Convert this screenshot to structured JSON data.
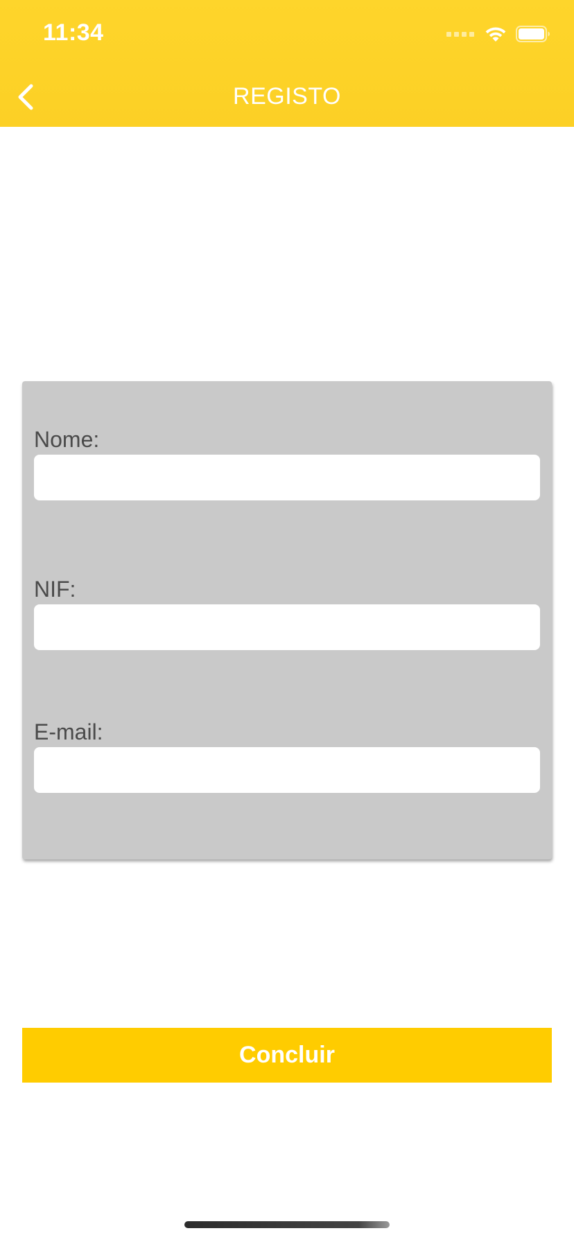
{
  "status_bar": {
    "time": "11:34",
    "wifi_icon": "wifi-icon",
    "battery_icon": "battery-icon"
  },
  "nav": {
    "back_icon": "chevron-left-icon",
    "title": "REGISTO"
  },
  "form": {
    "fields": [
      {
        "label": "Nome:",
        "value": "",
        "placeholder": ""
      },
      {
        "label": "NIF:",
        "value": "",
        "placeholder": ""
      },
      {
        "label": "E-mail:",
        "value": "",
        "placeholder": ""
      }
    ]
  },
  "actions": {
    "submit_label": "Concluir"
  },
  "colors": {
    "header": "#fed52b",
    "button": "#ffcc00",
    "card": "#c9c9c9",
    "label_text": "#4a4a4a"
  }
}
